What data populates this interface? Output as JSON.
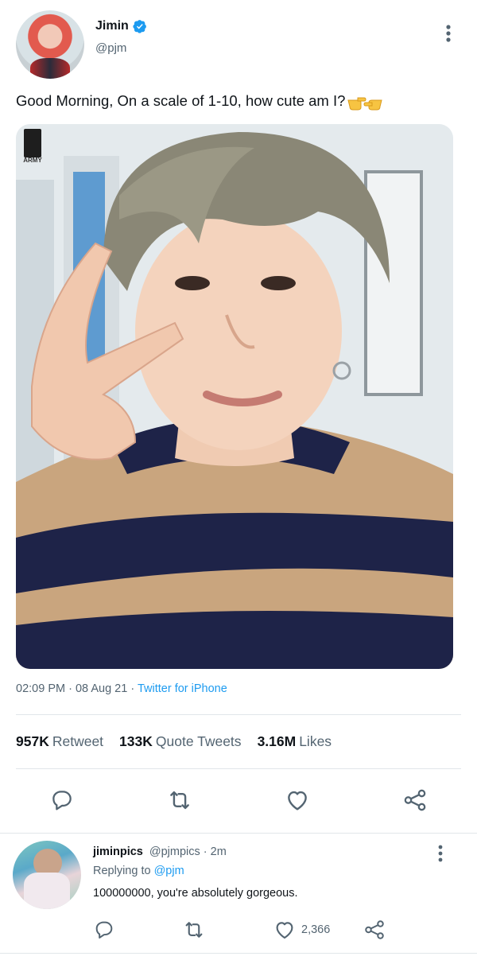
{
  "tweet": {
    "display_name": "Jimin",
    "handle": "@pjm",
    "text": "Good Morning, On a scale of 1-10, how cute am I?",
    "emoji": "👉👈",
    "time": "02:09 PM",
    "date": "08 Aug 21",
    "source": "Twitter for iPhone",
    "separator": "·",
    "photo_badge": "ARMY"
  },
  "stats": {
    "retweets": "957K",
    "retweets_label": "Retweet",
    "quotes": "133K",
    "quotes_label": "Quote Tweets",
    "likes": "3.16M",
    "likes_label": "Likes"
  },
  "actions": {
    "icons": [
      "reply-icon",
      "retweet-icon",
      "like-icon",
      "share-icon"
    ]
  },
  "reply": {
    "display_name": "jiminpics",
    "handle": "@pjmpics",
    "time": "2m",
    "separator": "·",
    "replying_prefix": "Replying to",
    "replying_to": "@pjm",
    "text": "100000000, you're absolutely gorgeous.",
    "likes": "2,366"
  },
  "colors": {
    "accent": "#1d9bf0",
    "text": "#0f1419",
    "muted": "#536471",
    "divider": "#e1e6ea"
  }
}
